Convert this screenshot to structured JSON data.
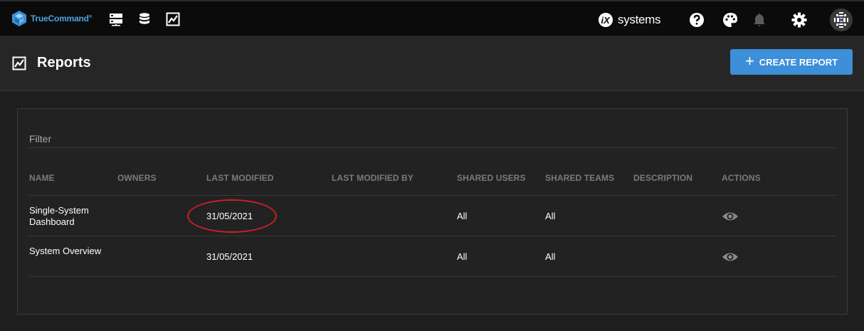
{
  "topbar": {
    "logo_text": "TrueCommand",
    "logo_reg": "®",
    "brand_text": "systems",
    "nav_icons": [
      "servers-icon",
      "database-icon",
      "reports-chart-icon"
    ],
    "right_icons": [
      "help-icon",
      "palette-icon",
      "bell-icon",
      "gear-icon",
      "avatar"
    ]
  },
  "header": {
    "title": "Reports",
    "create_label": "CREATE REPORT"
  },
  "filter": {
    "label": "Filter"
  },
  "table": {
    "columns": [
      "NAME",
      "OWNERS",
      "LAST MODIFIED",
      "LAST MODIFIED BY",
      "SHARED USERS",
      "SHARED TEAMS",
      "DESCRIPTION",
      "ACTIONS"
    ],
    "rows": [
      {
        "name": "Single-System Dashboard",
        "owners": "",
        "last_modified": "31/05/2021",
        "last_modified_by": "",
        "shared_users": "All",
        "shared_teams": "All",
        "description": ""
      },
      {
        "name": "System Overview",
        "owners": "",
        "last_modified": "31/05/2021",
        "last_modified_by": "",
        "shared_users": "All",
        "shared_teams": "All",
        "description": ""
      }
    ]
  },
  "colors": {
    "accent": "#3c8fd8",
    "logo": "#4ea3e0",
    "annotation": "#d11f1f"
  }
}
